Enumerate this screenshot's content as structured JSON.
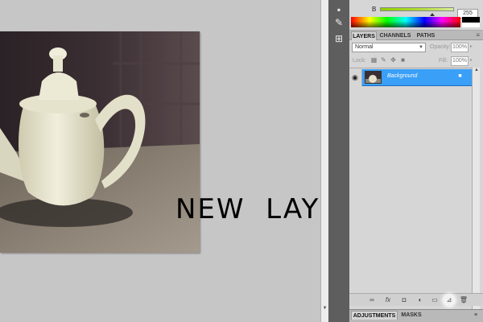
{
  "color_panel": {
    "b_label": "B",
    "b_value": "255",
    "b_slider_fraction": 0.71
  },
  "layers_panel": {
    "tabs": [
      {
        "label": "LAYERS",
        "active": true
      },
      {
        "label": "CHANNELS",
        "active": false
      },
      {
        "label": "PATHS",
        "active": false
      }
    ],
    "blend_mode": "Normal",
    "opacity_label": "Opacity:",
    "opacity_value": "100%",
    "lock_label": "Lock:",
    "fill_label": "Fill:",
    "fill_value": "100%",
    "layer": {
      "name": "Background",
      "icons": {
        "visibility": "eye-icon",
        "lock": "lock-icon"
      }
    },
    "footer_icons": [
      "link-layers-icon",
      "fx-icon",
      "add-mask-icon",
      "adjustment-layer-icon",
      "new-group-icon",
      "new-layer-icon",
      "trash-icon"
    ]
  },
  "adjustments_panel": {
    "tabs": [
      {
        "label": "ADJUSTMENTS",
        "active": true
      },
      {
        "label": "MASKS",
        "active": false
      }
    ]
  },
  "annotation": {
    "text": "NEW  LAYER"
  },
  "colors": {
    "selection_blue": "#3a9ff6",
    "panel_gray": "#d6d6d6",
    "dock_gray": "#5e5e5e",
    "canvas_gray": "#c6c6c6"
  }
}
